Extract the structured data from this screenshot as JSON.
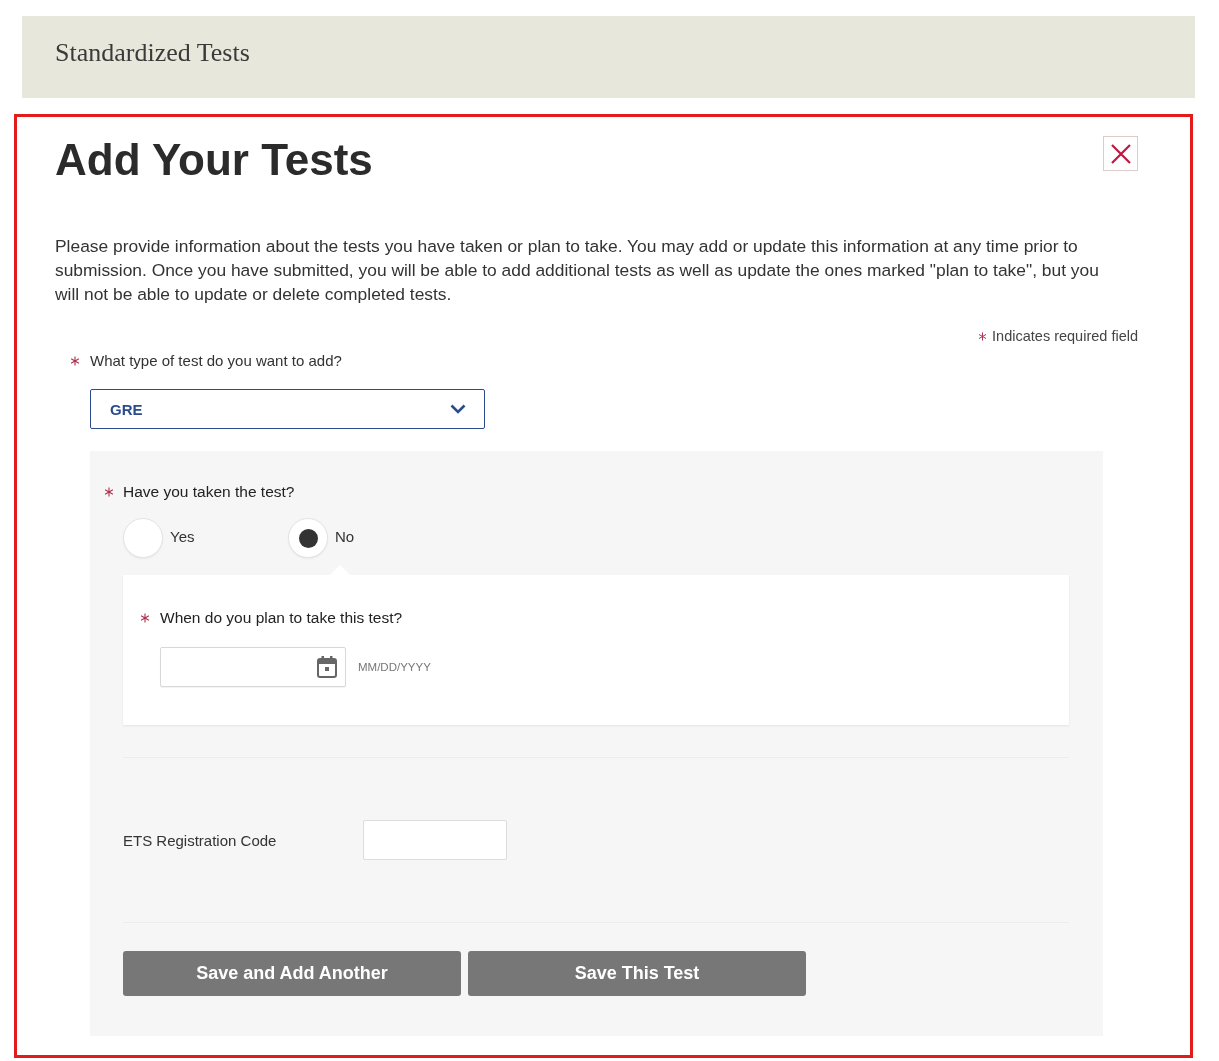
{
  "header": {
    "title": "Standardized Tests"
  },
  "dialog": {
    "title": "Add Your Tests",
    "intro": "Please provide information about the tests you have taken or plan to take. You may add or update this information at any time prior to submission. Once you have submitted, you will be able to add additional tests as well as update the ones marked \"plan to take\", but you will not be able to update or delete completed tests.",
    "required_note": "Indicates required field",
    "test_type": {
      "label": "What type of test do you want to add?",
      "required": true,
      "value": "GRE"
    },
    "taken": {
      "label": "Have you taken the test?",
      "required": true,
      "options": [
        {
          "label": "Yes",
          "selected": false
        },
        {
          "label": "No",
          "selected": true
        }
      ]
    },
    "plan_date": {
      "label": "When do you plan to take this test?",
      "required": true,
      "format_hint": "MM/DD/YYYY"
    },
    "registration_code": {
      "label": "ETS Registration Code"
    },
    "buttons": [
      {
        "label": "Save and Add Another"
      },
      {
        "label": "Save This Test"
      }
    ]
  }
}
